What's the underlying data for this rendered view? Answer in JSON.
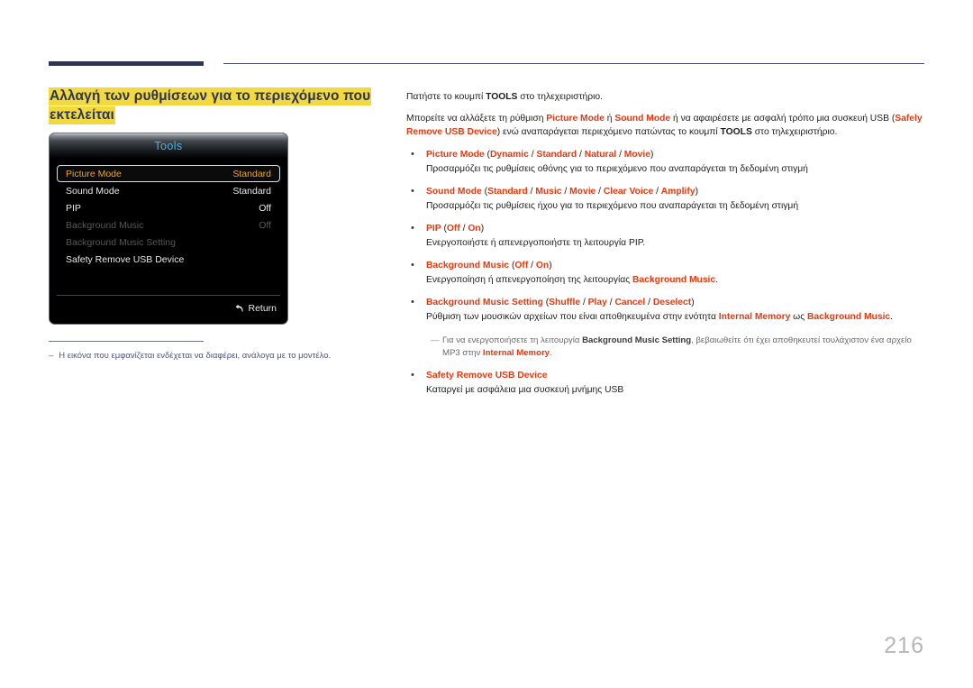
{
  "document": {
    "page_number": "216",
    "heading": "Αλλαγή των ρυθμίσεων για το περιεχόμενο που εκτελείται",
    "footnote_dash": "–",
    "footnote": "Η εικόνα που εμφανίζεται ενδέχεται να διαφέρει, ανάλογα με το μοντέλο."
  },
  "osd": {
    "title": "Tools",
    "rows": [
      {
        "label": "Picture Mode",
        "value": "Standard",
        "state": "selected"
      },
      {
        "label": "Sound Mode",
        "value": "Standard",
        "state": "normal"
      },
      {
        "label": "PIP",
        "value": "Off",
        "state": "normal"
      },
      {
        "label": "Background Music",
        "value": "Off",
        "state": "disabled"
      },
      {
        "label": "Background Music Setting",
        "value": "",
        "state": "disabled"
      },
      {
        "label": "Safety Remove USB Device",
        "value": "",
        "state": "normal"
      }
    ],
    "return_label": "Return",
    "return_icon": "↰"
  },
  "body": {
    "p1_a": "Πατήστε το κουμπί ",
    "p1_b": "TOOLS",
    "p1_c": " στο τηλεχειριστήριο.",
    "p2_a": "Μπορείτε να αλλάξετε τη ρύθμιση ",
    "p2_b": "Picture Mode",
    "p2_c": " ή ",
    "p2_d": "Sound Mode",
    "p2_e": " ή να αφαιρέσετε με ασφαλή τρόπο μια συσκευή USB (",
    "p2_f": "Safely Remove USB Device",
    "p2_g": ") ενώ αναπαράγεται περιεχόμενο πατώντας το κουμπί ",
    "p2_h": "TOOLS",
    "p2_i": " στο τηλεχειριστήριο."
  },
  "bullets": [
    {
      "marker": "•",
      "name": "Picture Mode",
      "options_open": " (",
      "options": [
        "Dynamic",
        "Standard",
        "Natural",
        "Movie"
      ],
      "options_close": ")",
      "desc": "Προσαρμόζει τις ρυθμίσεις οθόνης για το περιεχόμενο που αναπαράγεται τη δεδομένη στιγμή"
    },
    {
      "marker": "•",
      "name": "Sound Mode",
      "options_open": " (",
      "options": [
        "Standard",
        "Music",
        "Movie",
        "Clear Voice",
        "Amplify"
      ],
      "options_close": ")",
      "desc": "Προσαρμόζει τις ρυθμίσεις ήχου για το περιεχόμενο που αναπαράγεται τη δεδομένη στιγμή"
    },
    {
      "marker": "•",
      "name": "PIP",
      "options_open": " (",
      "options": [
        "Off",
        "On"
      ],
      "options_close": ")",
      "desc": "Ενεργοποιήστε ή απενεργοποιήστε τη λειτουργία PIP."
    },
    {
      "marker": "•",
      "name": "Background Music",
      "options_open": " (",
      "options": [
        "Off",
        "On"
      ],
      "options_close": ")",
      "desc_a": "Ενεργοποίηση ή απενεργοποίηση της λειτουργίας ",
      "desc_red": "Background Music",
      "desc_b": "."
    }
  ],
  "bullet_bgms": {
    "marker": "•",
    "name": "Background Music Setting",
    "options_open": " (",
    "options": [
      "Shuffle",
      "Play",
      "Cancel",
      "Deselect"
    ],
    "options_close": ")",
    "desc_a": "Ρύθμιση των μουσικών αρχείων που είναι αποθηκευμένα στην ενότητα ",
    "desc_red1": "Internal Memory",
    "desc_b": " ως ",
    "desc_red2": "Background Music",
    "desc_c": "."
  },
  "note": {
    "dash": "—",
    "a": "Για να ενεργοποιήσετε τη λειτουργία ",
    "bold": "Background Music Setting",
    "b": ", βεβαιωθείτε ότι έχει αποθηκευτεί τουλάχιστον ένα αρχείο MP3 στην ",
    "red": "Internal Memory",
    "c": "."
  },
  "bullet_safety": {
    "marker": "•",
    "name": "Safety Remove USB Device",
    "desc": "Καταργεί με ασφάλεια μια συσκευή μνήμης USB"
  },
  "colors": {
    "accent_red": "#e8380d",
    "heading_navy": "#2c3357",
    "highlight_yellow": "#f2d93f",
    "osd_selected_orange": "#f0a61d",
    "osd_title_blue": "#45b6e8",
    "rule_navy": "#2d3553"
  }
}
